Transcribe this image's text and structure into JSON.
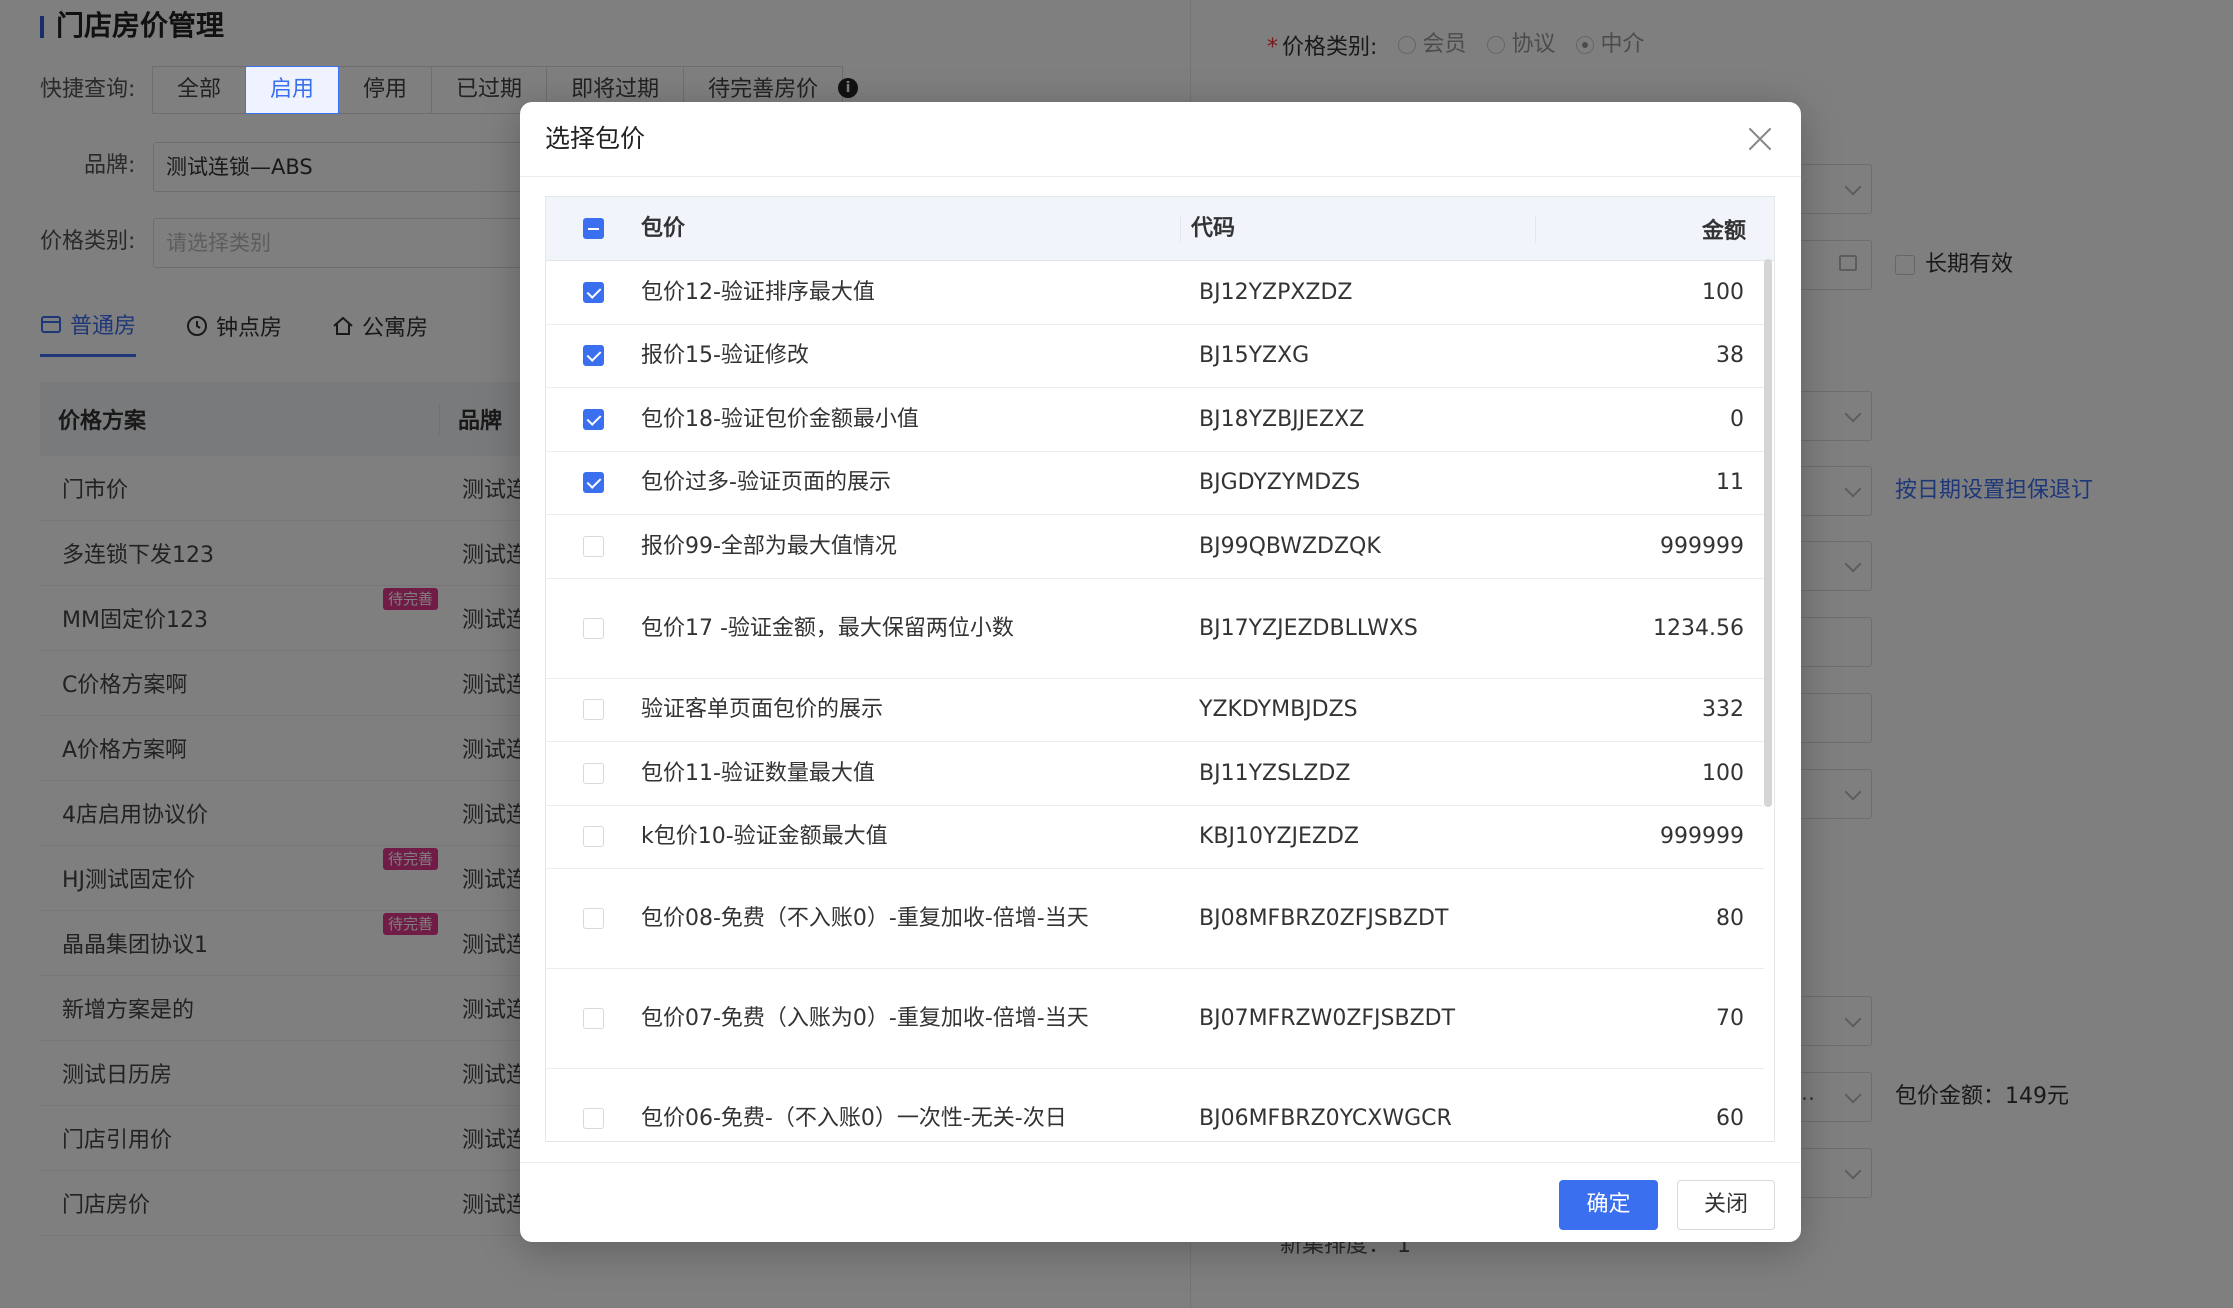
{
  "background": {
    "title": "门店房价管理",
    "quick_query_label": "快捷查询:",
    "quick_tabs": [
      "全部",
      "启用",
      "停用",
      "已过期",
      "即将过期",
      "待完善房价"
    ],
    "active_quick_tab": "启用",
    "brand_label": "品牌:",
    "brand_value": "测试连锁—ABS",
    "price_type_label": "价格类别:",
    "price_type_placeholder": "请选择类别",
    "room_tabs": [
      "普通房",
      "钟点房",
      "公寓房"
    ],
    "table_headers": [
      "价格方案",
      "品牌"
    ],
    "rows": [
      {
        "name": "门市价",
        "brand": "测试连",
        "pending": false
      },
      {
        "name": "多连锁下发123",
        "brand": "测试连",
        "pending": false
      },
      {
        "name": "MM固定价123",
        "brand": "测试连",
        "pending": true
      },
      {
        "name": "C价格方案啊",
        "brand": "测试连",
        "pending": false
      },
      {
        "name": "A价格方案啊",
        "brand": "测试连",
        "pending": false
      },
      {
        "name": "4店启用协议价",
        "brand": "测试连",
        "pending": false
      },
      {
        "name": "HJ测试固定价",
        "brand": "测试连",
        "pending": true
      },
      {
        "name": "晶晶集团协议1",
        "brand": "测试连",
        "pending": true
      },
      {
        "name": "新增方案是的",
        "brand": "测试连",
        "pending": false
      },
      {
        "name": "测试日历房",
        "brand": "测试连",
        "pending": false
      },
      {
        "name": "门店引用价",
        "brand": "测试连",
        "pending": false
      },
      {
        "name": "门店房价",
        "brand": "测试连",
        "pending": false
      }
    ],
    "pending_tag": "待完善",
    "right": {
      "price_category_label": "价格类别:",
      "radios": [
        "会员",
        "协议",
        "中介"
      ],
      "long_term_label": "长期有效",
      "guarantee_link": "按日期设置担保退订",
      "package_amount": "包价金额：149元",
      "truncated_value": "...",
      "bottom_label": "新集排度：",
      "bottom_value": "1"
    }
  },
  "modal": {
    "title": "选择包价",
    "columns": {
      "name": "包价",
      "code": "代码",
      "amount": "金额"
    },
    "rows": [
      {
        "checked": true,
        "name": "包价12-验证排序最大值",
        "code": "BJ12YZPXZDZ",
        "amount": "100"
      },
      {
        "checked": true,
        "name": "报价15-验证修改",
        "code": "BJ15YZXG",
        "amount": "38"
      },
      {
        "checked": true,
        "name": "包价18-验证包价金额最小值",
        "code": "BJ18YZBJJEZXZ",
        "amount": "0"
      },
      {
        "checked": true,
        "name": "包价过多-验证页面的展示",
        "code": "BJGDYZYMDZS",
        "amount": "11"
      },
      {
        "checked": false,
        "name": "报价99-全部为最大值情况",
        "code": "BJ99QBWZDZQK",
        "amount": "999999"
      },
      {
        "checked": false,
        "name": "包价17 -验证金额，最大保留两位小数",
        "code": "BJ17YZJEZDBLLWXS",
        "amount": "1234.56"
      },
      {
        "checked": false,
        "name": "验证客单页面包价的展示",
        "code": "YZKDYMBJDZS",
        "amount": "332"
      },
      {
        "checked": false,
        "name": "包价11-验证数量最大值",
        "code": "BJ11YZSLZDZ",
        "amount": "100"
      },
      {
        "checked": false,
        "name": "k包价10-验证金额最大值",
        "code": "KBJ10YZJEZDZ",
        "amount": "999999"
      },
      {
        "checked": false,
        "name": "包价08-免费（不入账0）-重复加收-倍增-当天",
        "code": "BJ08MFBRZ0ZFJSBZDT",
        "amount": "80"
      },
      {
        "checked": false,
        "name": "包价07-免费（入账为0）-重复加收-倍增-当天",
        "code": "BJ07MFRZW0ZFJSBZDT",
        "amount": "70"
      },
      {
        "checked": false,
        "name": "包价06-免费-（不入账0）一次性-无关-次日",
        "code": "BJ06MFBRZ0YCXWGCR",
        "amount": "60"
      }
    ],
    "confirm_label": "确定",
    "close_label": "关闭"
  }
}
